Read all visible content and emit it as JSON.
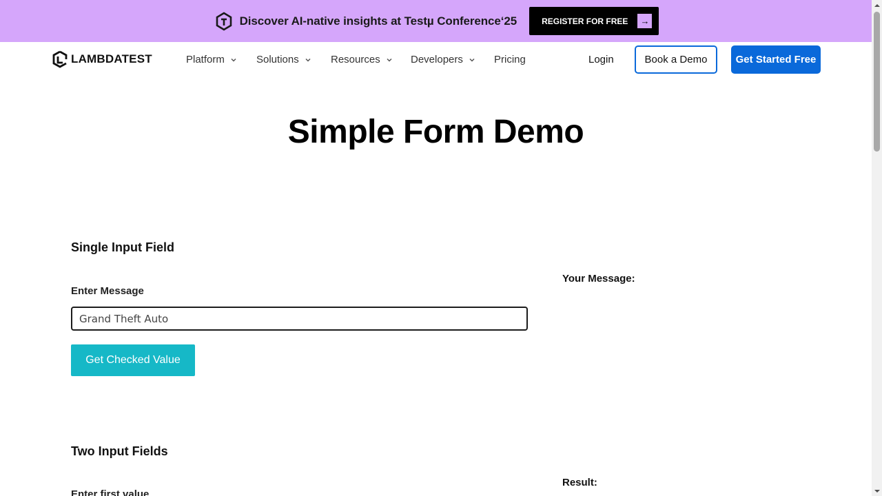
{
  "banner": {
    "text": "Discover AI-native insights at Testµ Conference‘25",
    "register_label": "REGISTER FOR FREE",
    "arrow": "→",
    "logo_icon": "testmu-logo-icon",
    "bg_color": "#d5a6fb"
  },
  "nav": {
    "brand": "LAMBDATEST",
    "brand_icon": "lambdatest-logo-icon",
    "items": [
      {
        "label": "Platform",
        "dropdown": true
      },
      {
        "label": "Solutions",
        "dropdown": true
      },
      {
        "label": "Resources",
        "dropdown": true
      },
      {
        "label": "Developers",
        "dropdown": true
      },
      {
        "label": "Pricing",
        "dropdown": false
      }
    ],
    "login": "Login",
    "book_demo": "Book a Demo",
    "get_started": "Get Started Free",
    "accent_color": "#0a69da"
  },
  "page": {
    "title": "Simple Form Demo"
  },
  "single_input": {
    "section_title": "Single Input Field",
    "label": "Enter Message",
    "value": "Grand Theft Auto",
    "button": "Get Checked Value",
    "button_color": "#16b8c7",
    "result_label": "Your Message:"
  },
  "two_inputs": {
    "section_title": "Two Input Fields",
    "first_label": "Enter first value",
    "result_label": "Result:"
  }
}
